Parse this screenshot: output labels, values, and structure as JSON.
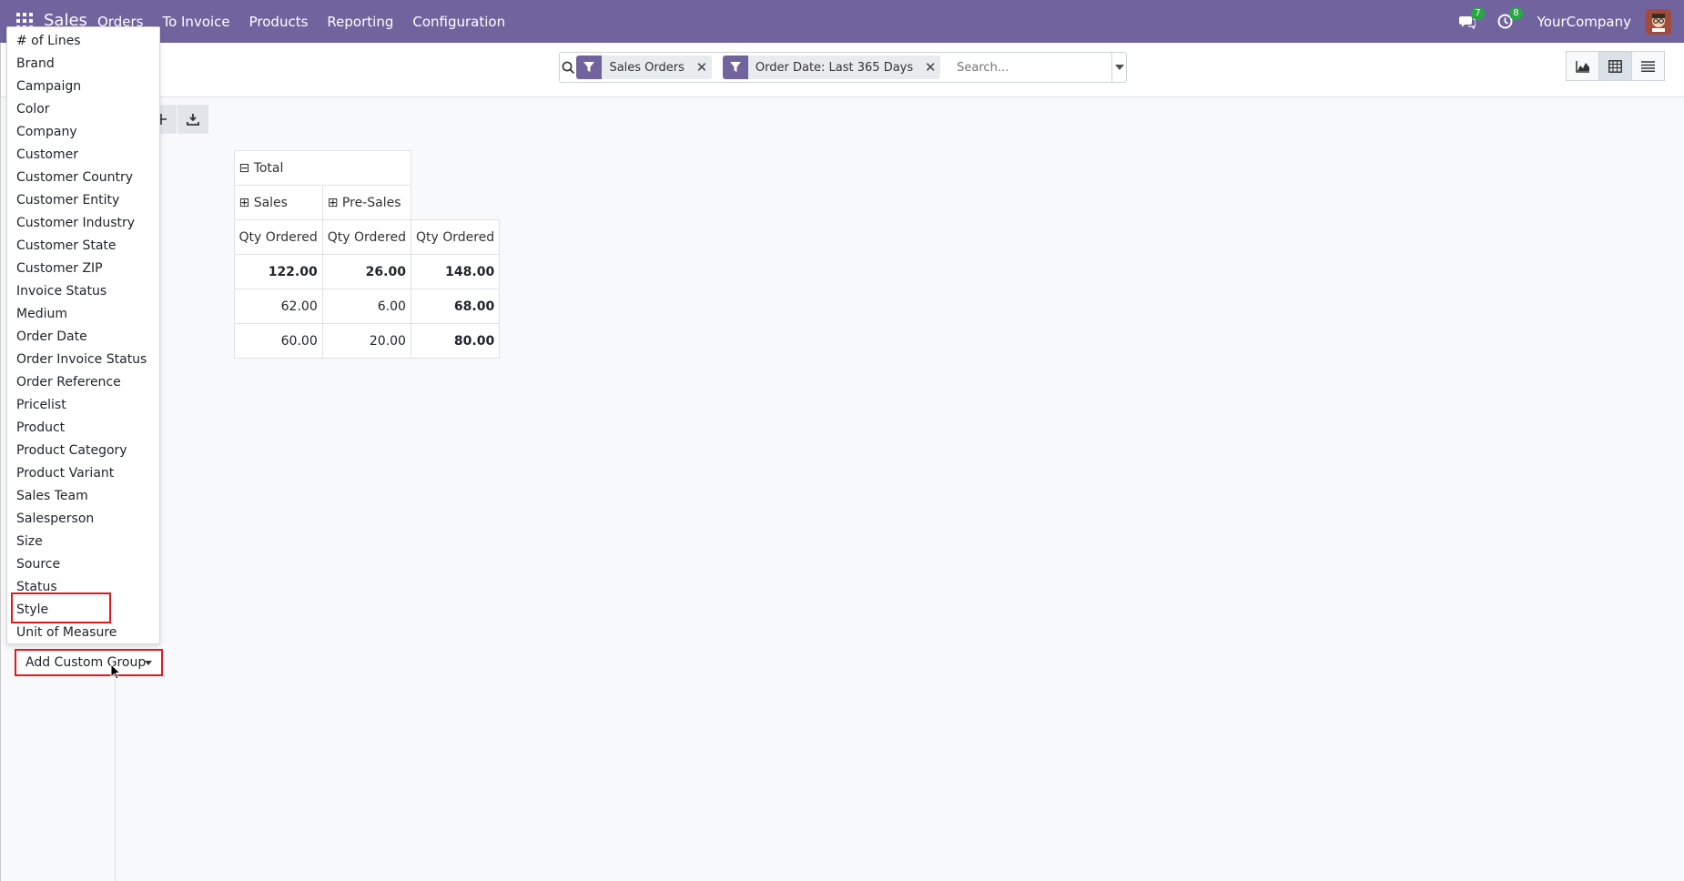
{
  "navbar": {
    "brand": "Sales",
    "menu": [
      "Orders",
      "To Invoice",
      "Products",
      "Reporting",
      "Configuration"
    ],
    "messages_count": "7",
    "activities_count": "8",
    "company": "YourCompany",
    "color": "#71639e"
  },
  "search": {
    "facets": [
      {
        "label": "Sales Orders"
      },
      {
        "label": "Order Date: Last 365 Days"
      }
    ],
    "placeholder": "Search..."
  },
  "views": [
    "graph-view",
    "pivot-view",
    "list-view"
  ],
  "pivot": {
    "header_total": "Total",
    "header_sales": "Sales",
    "header_presales": "Pre-Sales",
    "measure": "Qty Ordered",
    "rows": [
      [
        "122.00",
        "26.00",
        "148.00"
      ],
      [
        "62.00",
        "6.00",
        "68.00"
      ],
      [
        "60.00",
        "20.00",
        "80.00"
      ]
    ]
  },
  "dropdown": {
    "items": [
      "# of Lines",
      "Brand",
      "Campaign",
      "Color",
      "Company",
      "Customer",
      "Customer Country",
      "Customer Entity",
      "Customer Industry",
      "Customer State",
      "Customer ZIP",
      "Invoice Status",
      "Medium",
      "Order Date",
      "Order Invoice Status",
      "Order Reference",
      "Pricelist",
      "Product",
      "Product Category",
      "Product Variant",
      "Sales Team",
      "Salesperson",
      "Size",
      "Source",
      "Status",
      "Style",
      "Unit of Measure"
    ],
    "highlighted": "Style",
    "custom_group_label": "Add Custom Group",
    "highlight_color": "#e0191e"
  }
}
